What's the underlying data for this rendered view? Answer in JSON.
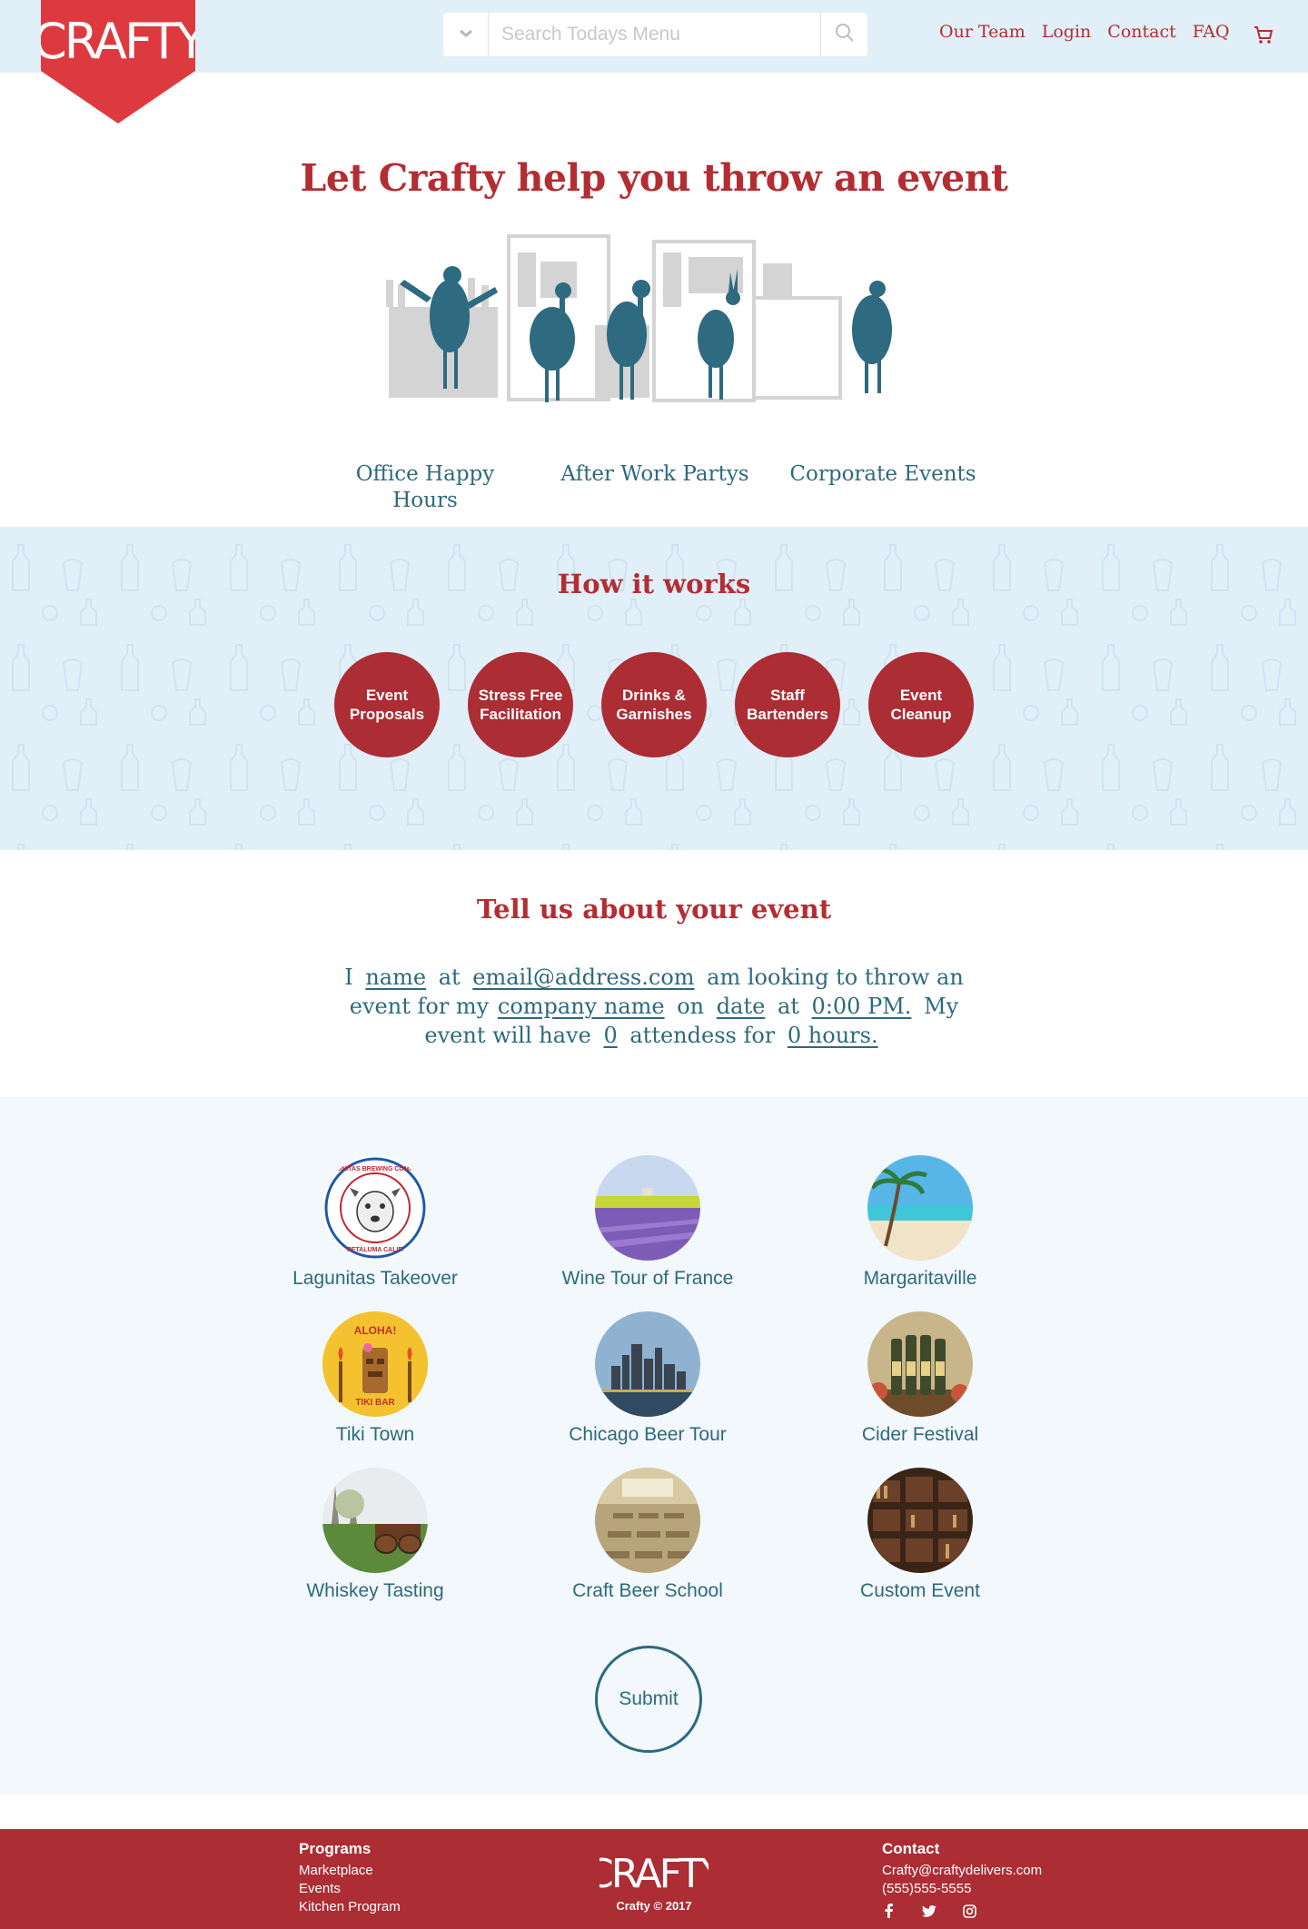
{
  "header": {
    "logo_text": "CRAFTY",
    "search_placeholder": "Search Todays Menu",
    "nav": [
      "Our Team",
      "Login",
      "Contact",
      "FAQ"
    ]
  },
  "hero": {
    "title": "Let Crafty help you throw an event",
    "event_types": [
      "Office Happy Hours",
      "After Work Partys",
      "Corporate Events"
    ]
  },
  "how_it_works": {
    "title": "How it works",
    "steps": [
      "Event Proposals",
      "Stress Free Facilitation",
      "Drinks & Garnishes",
      "Staff Bartenders",
      "Event Cleanup"
    ]
  },
  "tell_us": {
    "title": "Tell us about your event",
    "t1": "I",
    "name": "name",
    "t2": "at",
    "email": "email@address.com",
    "t3": "am looking to throw an event for my",
    "company": "company name",
    "t4": "on",
    "date": "date",
    "t5": "at",
    "time": "0:00 PM.",
    "t6": "My event will have",
    "attendees": "0",
    "t7": "attendess for",
    "hours": "0  hours."
  },
  "options": [
    {
      "label": "Lagunitas Takeover",
      "logo_top": "LAGUNITAS BREWING COMPANY",
      "logo_bottom": "PETALUMA CALIF."
    },
    {
      "label": "Wine Tour of France"
    },
    {
      "label": "Margaritaville"
    },
    {
      "label": "Tiki Town",
      "logo_top": "ALOHA!",
      "logo_bottom": "TIKI BAR"
    },
    {
      "label": "Chicago Beer Tour"
    },
    {
      "label": "Cider Festival"
    },
    {
      "label": "Whiskey Tasting"
    },
    {
      "label": "Craft Beer School"
    },
    {
      "label": "Custom Event"
    }
  ],
  "submit_label": "Submit",
  "footer": {
    "programs_title": "Programs",
    "programs": [
      "Marketplace",
      "Events",
      "Kitchen Program"
    ],
    "logo_text": "CRAFTY",
    "copyright": "Crafty © 2017",
    "contact_title": "Contact",
    "email": "Crafty@craftydelivers.com",
    "phone": "(555)555-5555",
    "social_icons": [
      "facebook-icon",
      "twitter-icon",
      "instagram-icon"
    ]
  },
  "colors": {
    "brand_red": "#ac2d34",
    "title_red": "#b32d33",
    "teal": "#2c6a7e",
    "light_blue": "#e1eff8"
  }
}
